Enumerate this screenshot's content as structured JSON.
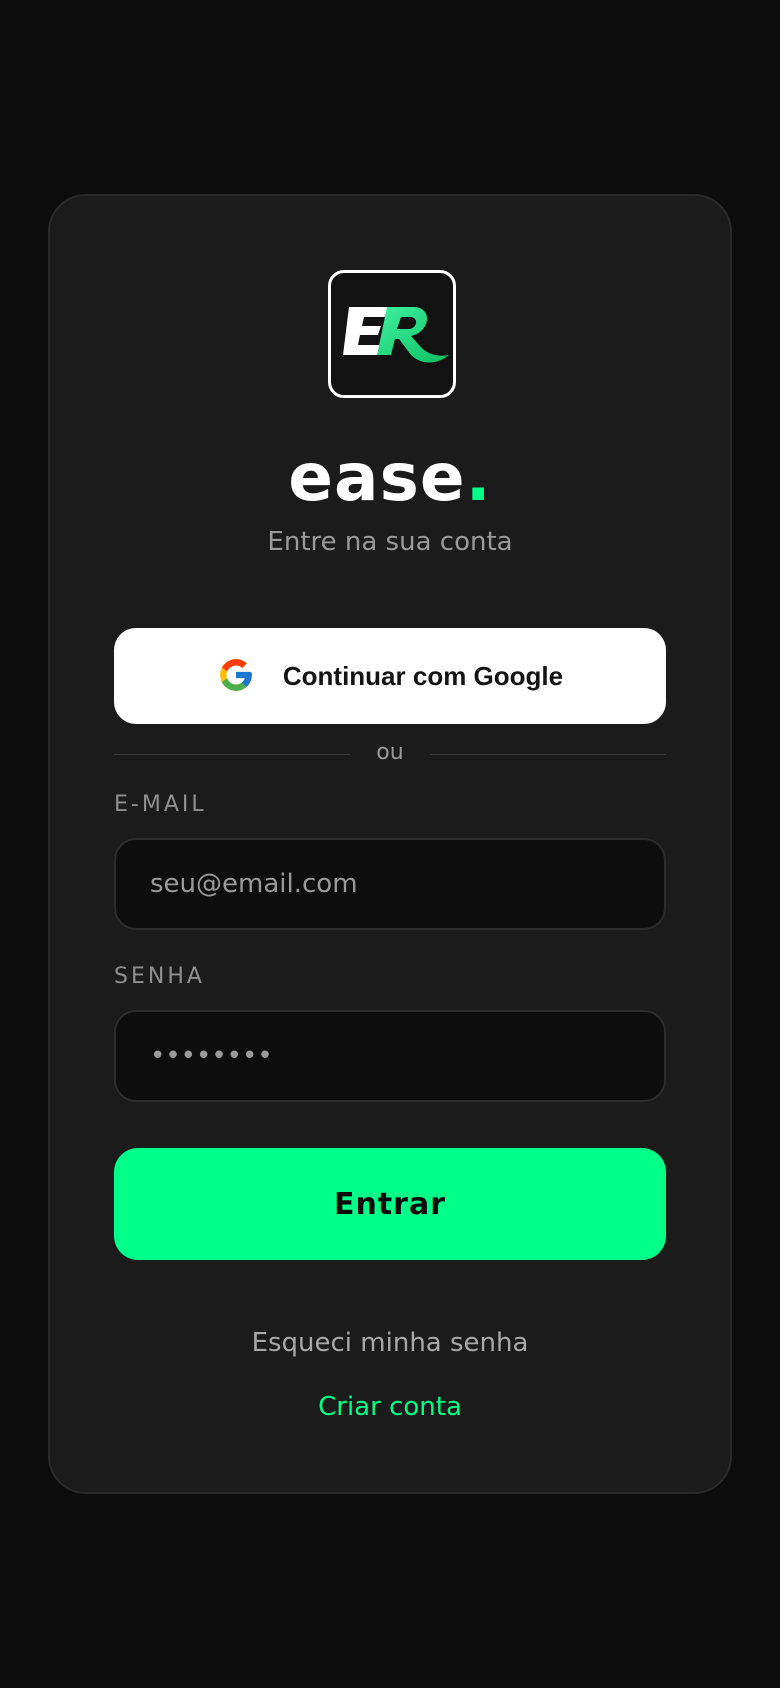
{
  "logo": {
    "initials": "ER",
    "icon": "er-logo-icon"
  },
  "brand": {
    "name": "ease",
    "dot": "."
  },
  "subtitle": "Entre na sua conta",
  "google_button": {
    "label": "Continuar com Google",
    "icon": "google-icon"
  },
  "divider": {
    "text": "ou"
  },
  "email": {
    "label": "E-MAIL",
    "placeholder": "seu@email.com",
    "value": ""
  },
  "password": {
    "label": "SENHA",
    "placeholder": "••••••••",
    "value": ""
  },
  "submit_button": {
    "label": "Entrar"
  },
  "links": {
    "forgot": "Esqueci minha senha",
    "create": "Criar conta"
  },
  "colors": {
    "accent": "#00ff88",
    "background": "#0c0c0c",
    "card": "#1b1b1b",
    "input_bg": "#0d0d0d",
    "muted_text": "#9a9a9a"
  }
}
